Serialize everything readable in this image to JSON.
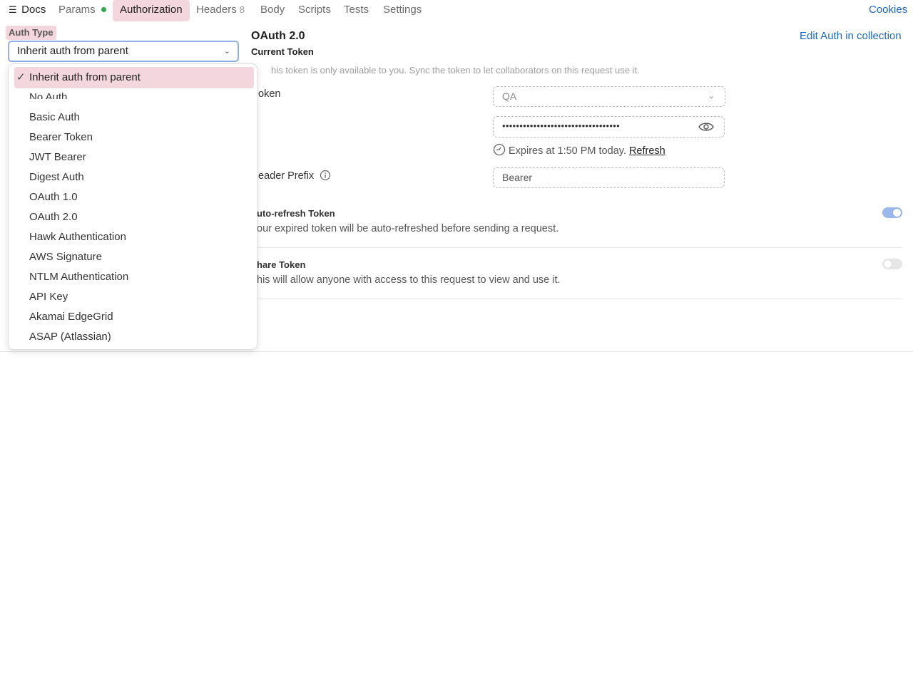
{
  "tabs": {
    "docs": "Docs",
    "params": "Params",
    "authorization": "Authorization",
    "headers": "Headers",
    "headers_count": "8",
    "body": "Body",
    "scripts": "Scripts",
    "tests": "Tests",
    "settings": "Settings",
    "cookies": "Cookies",
    "params_dot_color": "#2fa84f",
    "active_highlight": "#f3d6de"
  },
  "auth": {
    "type_label": "Auth Type",
    "selected_value": "Inherit auth from parent",
    "options": [
      "Inherit auth from parent",
      "No Auth",
      "Basic Auth",
      "Bearer Token",
      "JWT Bearer",
      "Digest Auth",
      "OAuth 1.0",
      "OAuth 2.0",
      "Hawk Authentication",
      "AWS Signature",
      "NTLM Authentication",
      "API Key",
      "Akamai EdgeGrid",
      "ASAP (Atlassian)"
    ]
  },
  "oauth": {
    "title": "OAuth 2.0",
    "edit_link": "Edit Auth in collection",
    "current_token_heading": "Current Token",
    "token_note": "his token is only available to you. Sync the token to let collaborators on this request use it.",
    "token_label": "oken",
    "token_select_value": "QA",
    "token_masked": "••••••••••••••••••••••••••••••••••",
    "expires_text": "Expires at 1:50 PM today.",
    "refresh_label": "Refresh",
    "header_prefix_label": "eader Prefix",
    "header_prefix_value": "Bearer",
    "auto_refresh_title": "uto-refresh Token",
    "auto_refresh_desc": "our expired token will be auto-refreshed before sending a request.",
    "auto_refresh_on": true,
    "share_title": "hare Token",
    "share_desc": "his will allow anyone with access to this request to view and use it.",
    "share_on": false
  },
  "icons": {
    "docs": "docs-icon",
    "chevron": "chevron-down-icon",
    "eye": "eye-icon",
    "clock": "clock-icon",
    "info": "info-icon",
    "check": "check-icon"
  }
}
